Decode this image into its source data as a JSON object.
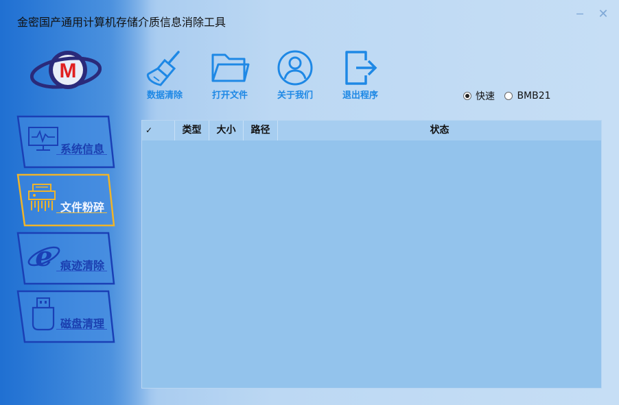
{
  "window": {
    "title": "金密国产通用计算机存储介质信息消除工具",
    "minimize_glyph": "─",
    "close_glyph": "✕"
  },
  "logo": {
    "letter": "M"
  },
  "sidebar": {
    "items": [
      {
        "label": "系统信息",
        "icon": "monitor-icon",
        "active": false
      },
      {
        "label": "文件粉碎",
        "icon": "shredder-icon",
        "active": true
      },
      {
        "label": "痕迹清除",
        "icon": "ie-browser-icon",
        "active": false
      },
      {
        "label": "磁盘清理",
        "icon": "usb-drive-icon",
        "active": false
      }
    ]
  },
  "toolbar": {
    "items": [
      {
        "label": "数据清除",
        "icon": "broom-icon"
      },
      {
        "label": "打开文件",
        "icon": "folder-icon"
      },
      {
        "label": "关于我们",
        "icon": "user-icon"
      },
      {
        "label": "退出程序",
        "icon": "exit-icon"
      }
    ]
  },
  "mode": {
    "options": [
      {
        "label": "快速",
        "selected": true
      },
      {
        "label": "BMB21",
        "selected": false
      }
    ]
  },
  "table": {
    "columns": [
      "✓",
      "类型",
      "大小",
      "路径",
      "状态"
    ],
    "rows": []
  },
  "colors": {
    "accent": "#1e88e5",
    "sidebar_label": "#1b3fb0",
    "active_border": "#f0b429",
    "table_body": "#93c3ec",
    "table_header": "#a6cdf0"
  }
}
